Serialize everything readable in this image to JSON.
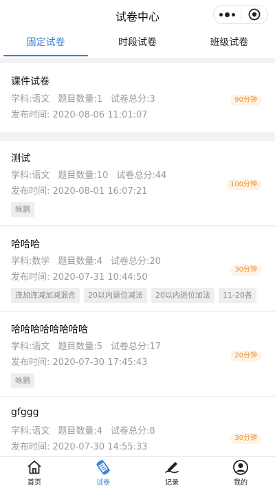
{
  "header": {
    "title": "试卷中心"
  },
  "tabs": [
    {
      "label": "固定试卷",
      "active": true
    },
    {
      "label": "时段试卷",
      "active": false
    },
    {
      "label": "班级试卷",
      "active": false
    }
  ],
  "cards": [
    {
      "title": "课件试卷",
      "subject": "学科:语文",
      "count": "题目数量:1",
      "score": "试卷总分:3",
      "publish": "发布时间:  2020-08-06 11:01:07",
      "duration": "90分钟",
      "tags": []
    },
    {
      "title": "测试",
      "subject": "学科:语文",
      "count": "题目数量:10",
      "score": "试卷总分:44",
      "publish": "发布时间:  2020-08-01 16:07:21",
      "duration": "100分钟",
      "tags": [
        "咏鹅"
      ]
    },
    {
      "title": "哈哈哈",
      "subject": "学科:数学",
      "count": "题目数量:4",
      "score": "试卷总分:20",
      "publish": "发布时间:  2020-07-31 10:44:50",
      "duration": "30分钟",
      "tags": [
        "连加连减加减混合",
        "20以内退位减法",
        "20以内进位加法",
        "11-20各"
      ]
    },
    {
      "title": "哈哈哈哈哈哈哈哈",
      "subject": "学科:语文",
      "count": "题目数量:5",
      "score": "试卷总分:17",
      "publish": "发布时间:  2020-07-30 17:45:43",
      "duration": "20分钟",
      "tags": [
        "咏鹅"
      ]
    },
    {
      "title": "gfggg",
      "subject": "学科:语文",
      "count": "题目数量:4",
      "score": "试卷总分:8",
      "publish": "发布时间:  2020-07-30 14:55:33",
      "duration": "30分钟",
      "tags": []
    }
  ],
  "bottom_nav": [
    {
      "label": "首页",
      "icon": "home-icon",
      "active": false
    },
    {
      "label": "试卷",
      "icon": "scroll-icon",
      "active": true
    },
    {
      "label": "记录",
      "icon": "pen-icon",
      "active": false
    },
    {
      "label": "我的",
      "icon": "user-icon",
      "active": false
    }
  ],
  "colors": {
    "accent": "#3b82d0",
    "duration_text": "#f28c28",
    "duration_bg": "#fff3e6"
  }
}
